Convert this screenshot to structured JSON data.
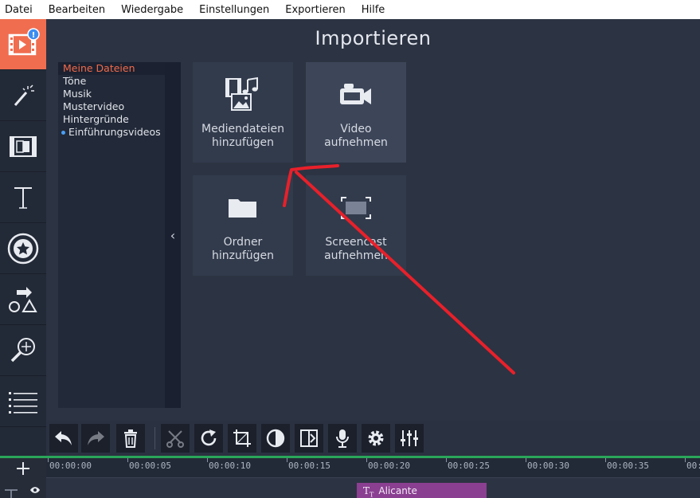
{
  "menu": {
    "items": [
      {
        "label": "Datei"
      },
      {
        "label": "Bearbeiten"
      },
      {
        "label": "Wiedergabe"
      },
      {
        "label": "Einstellungen"
      },
      {
        "label": "Exportieren"
      },
      {
        "label": "Hilfe"
      }
    ]
  },
  "rail": {
    "tools": [
      {
        "icon": "import-media-icon",
        "active": true,
        "badge": "!"
      },
      {
        "icon": "magic-wand-icon"
      },
      {
        "icon": "filmstrip-transition-icon"
      },
      {
        "icon": "text-titles-icon"
      },
      {
        "icon": "sticker-star-icon"
      },
      {
        "icon": "shapes-callouts-icon"
      },
      {
        "icon": "zoom-pan-icon"
      },
      {
        "icon": "more-list-icon"
      }
    ]
  },
  "main": {
    "title": "Importieren",
    "categories": [
      {
        "label": "Meine Dateien",
        "selected": true
      },
      {
        "label": "Töne"
      },
      {
        "label": "Musik"
      },
      {
        "label": "Mustervideo"
      },
      {
        "label": "Hintergründe"
      },
      {
        "label": "Einführungsvideos",
        "bullet": true
      }
    ],
    "collapse_glyph": "‹",
    "tiles": [
      {
        "label_line1": "Mediendateien",
        "label_line2": "hinzufügen",
        "icon": "media-files-icon"
      },
      {
        "label_line1": "Video",
        "label_line2": "aufnehmen",
        "icon": "video-camera-icon"
      },
      {
        "label_line1": "Ordner",
        "label_line2": "hinzufügen",
        "icon": "folder-icon"
      },
      {
        "label_line1": "Screencast",
        "label_line2": "aufnehmen",
        "icon": "screencast-icon"
      }
    ]
  },
  "toolbar": {
    "buttons": [
      {
        "icon": "undo-icon"
      },
      {
        "icon": "redo-icon",
        "disabled": true
      },
      {
        "icon": "delete-icon"
      },
      {
        "icon": "cut-icon",
        "disabled": true
      },
      {
        "icon": "rotate-icon"
      },
      {
        "icon": "crop-icon"
      },
      {
        "icon": "color-adjust-icon"
      },
      {
        "icon": "transition-icon"
      },
      {
        "icon": "microphone-icon"
      },
      {
        "icon": "settings-icon"
      },
      {
        "icon": "equalizer-icon"
      }
    ]
  },
  "timeline": {
    "timestamps": [
      "00:00:00",
      "00:00:05",
      "00:00:10",
      "00:00:15",
      "00:00:20",
      "00:00:25",
      "00:00:30",
      "00:00:35",
      "00:"
    ],
    "clip": {
      "label": "Alicante",
      "color": "#8a3f91"
    },
    "accent": "#2aa65a"
  },
  "colors": {
    "background": "#2c3342",
    "accent": "#f06d4f",
    "annotation": "#e8202a"
  }
}
